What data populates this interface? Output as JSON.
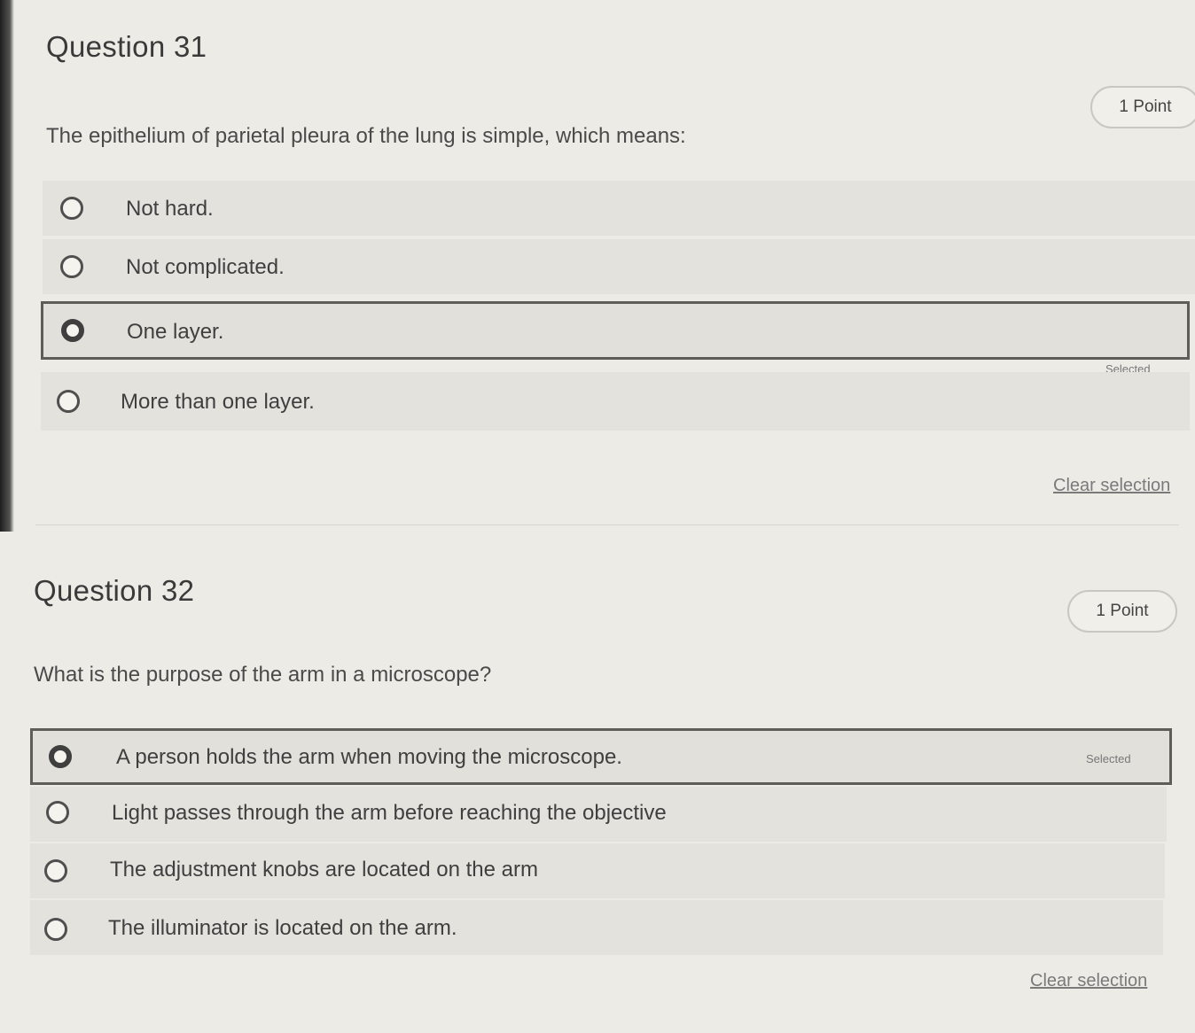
{
  "questions": [
    {
      "title": "Question 31",
      "points": "1 Point",
      "prompt": "The epithelium of parietal pleura of the lung is simple, which means:",
      "options": [
        {
          "label": "Not hard.",
          "selected": false
        },
        {
          "label": "Not complicated.",
          "selected": false
        },
        {
          "label": "One layer.",
          "selected": true
        },
        {
          "label": "More than one layer.",
          "selected": false
        }
      ],
      "selected_tag": "Selected",
      "clear_label": "Clear selection"
    },
    {
      "title": "Question 32",
      "points": "1 Point",
      "prompt": "What is the purpose of the arm in a microscope?",
      "options": [
        {
          "label": "A person holds the arm when moving the microscope.",
          "selected": true
        },
        {
          "label": "Light passes through the arm before reaching the objective",
          "selected": false
        },
        {
          "label": "The adjustment knobs are located on the arm",
          "selected": false
        },
        {
          "label": "The illuminator is located on the arm.",
          "selected": false
        }
      ],
      "selected_tag": "Selected",
      "clear_label": "Clear selection"
    }
  ]
}
